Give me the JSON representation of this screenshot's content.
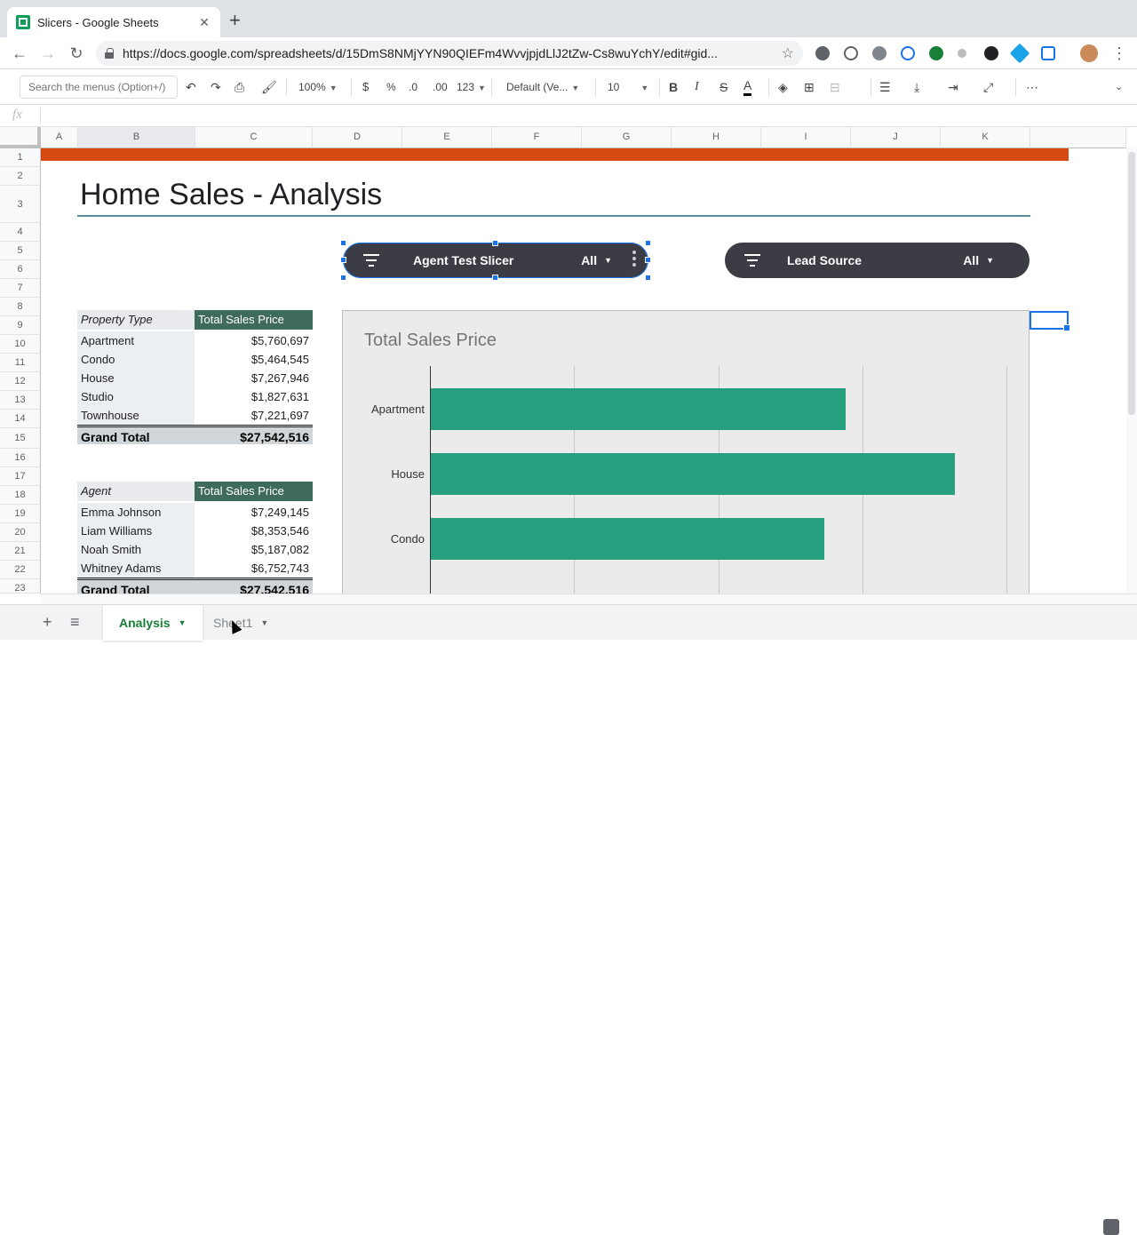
{
  "browser": {
    "tab_title": "Slicers - Google Sheets",
    "url": "https://docs.google.com/spreadsheets/d/15DmS8NMjYYN90QIEFm4WvvjpjdLlJ2tZw-Cs8wuYchY/edit#gid..."
  },
  "toolbar": {
    "search_placeholder": "Search the menus (Option+/)",
    "zoom": "100%",
    "currency": "$",
    "percent": "%",
    "dec_decrease": ".0",
    "dec_increase": ".00",
    "more_formats": "123",
    "font": "Default (Ve...",
    "font_size": "10",
    "bold": "B",
    "italic": "I",
    "strike": "S",
    "text_color": "A",
    "more": "⋯"
  },
  "formula_bar": {
    "fx": "fx"
  },
  "columns": [
    "A",
    "B",
    "C",
    "D",
    "E",
    "F",
    "G",
    "H",
    "I",
    "J",
    "K"
  ],
  "rows": [
    "1",
    "2",
    "3",
    "4",
    "5",
    "6",
    "7",
    "8",
    "9",
    "10",
    "11",
    "12",
    "13",
    "14",
    "15",
    "16",
    "17",
    "18",
    "19",
    "20",
    "21",
    "22",
    "23"
  ],
  "sheet": {
    "title": "Home Sales - Analysis",
    "slicers": [
      {
        "label": "Agent Test Slicer",
        "value": "All"
      },
      {
        "label": "Lead Source",
        "value": "All"
      }
    ],
    "property_table": {
      "header": [
        "Property Type",
        "Total Sales Price"
      ],
      "rows": [
        [
          "Apartment",
          "$5,760,697"
        ],
        [
          "Condo",
          "$5,464,545"
        ],
        [
          "House",
          "$7,267,946"
        ],
        [
          "Studio",
          "$1,827,631"
        ],
        [
          "Townhouse",
          "$7,221,697"
        ]
      ],
      "total": [
        "Grand Total",
        "$27,542,516"
      ]
    },
    "agent_table": {
      "header": [
        "Agent",
        "Total Sales Price"
      ],
      "rows": [
        [
          "Emma Johnson",
          "$7,249,145"
        ],
        [
          "Liam Williams",
          "$8,353,546"
        ],
        [
          "Noah Smith",
          "$5,187,082"
        ],
        [
          "Whitney Adams",
          "$6,752,743"
        ]
      ],
      "total": [
        "Grand Total",
        "$27,542,516"
      ]
    }
  },
  "chart_data": {
    "type": "bar",
    "title": "Total Sales Price",
    "categories": [
      "Apartment",
      "House",
      "Condo"
    ],
    "values": [
      5760697,
      7267946,
      5464545
    ],
    "xlim": [
      0,
      8000000
    ],
    "grid": true,
    "colors": {
      "bar": "#26a07f"
    }
  },
  "sheet_tabs": [
    {
      "label": "Analysis",
      "active": true
    },
    {
      "label": "Sheet1",
      "active": false
    }
  ]
}
